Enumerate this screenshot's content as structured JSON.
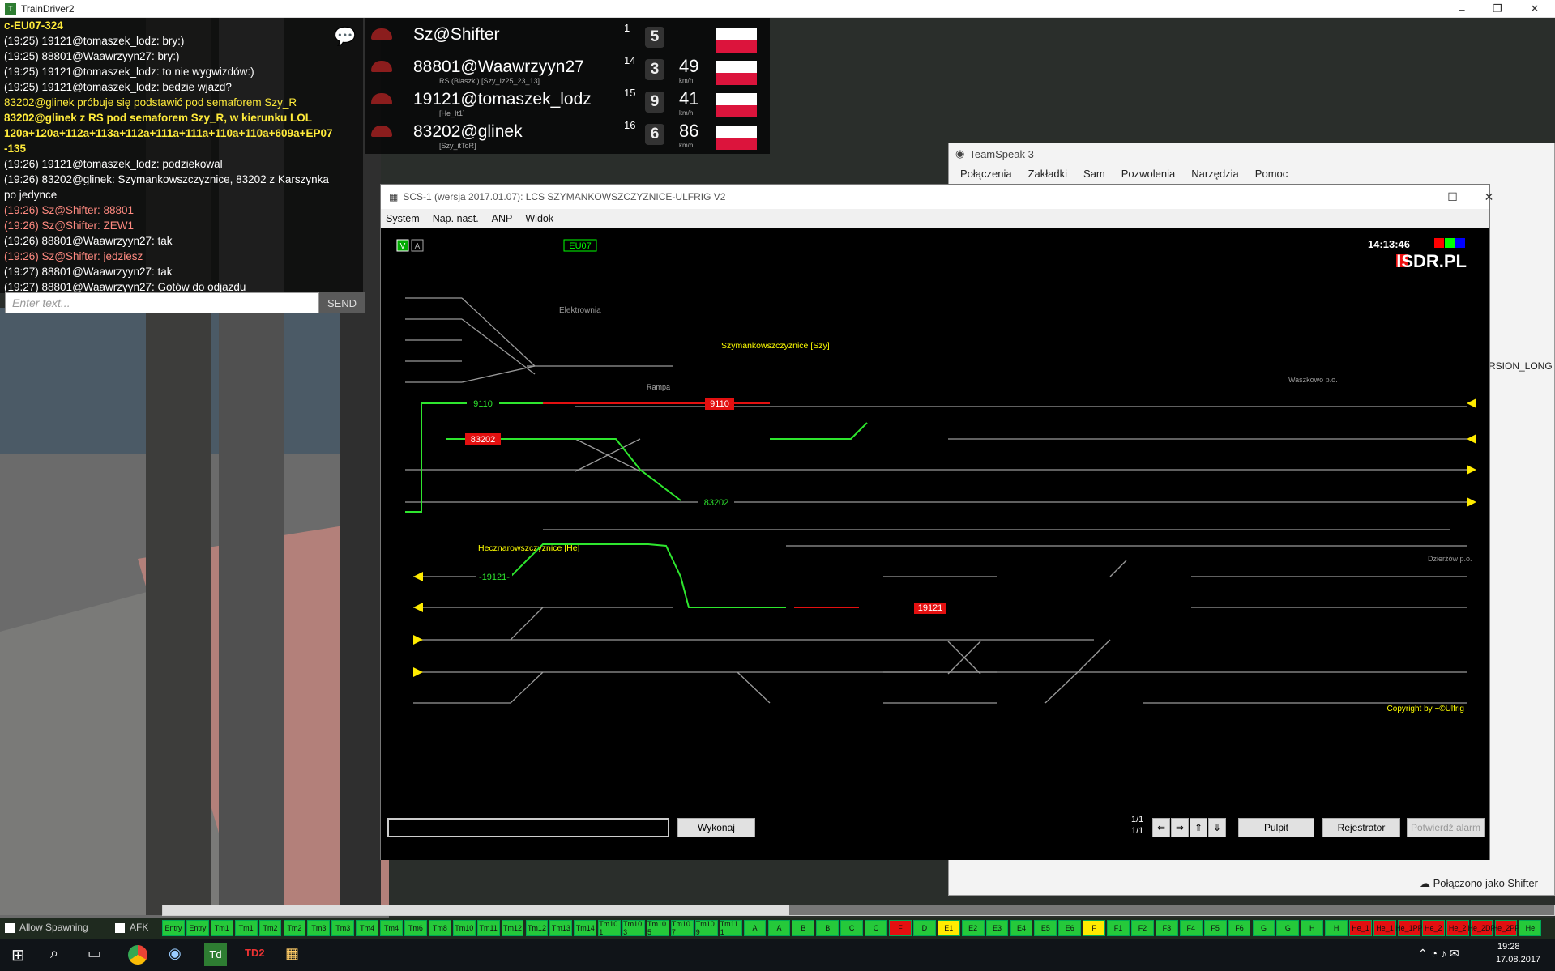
{
  "window_title": "TrainDriver2",
  "chat": {
    "lines": [
      {
        "t": "c-EU07-324",
        "c": "y"
      },
      {
        "t": "(19:25) 19121@tomaszek_lodz: bry:)",
        "c": ""
      },
      {
        "t": "(19:25) 88801@Waawrzyyn27: bry:)",
        "c": ""
      },
      {
        "t": "(19:25) 19121@tomaszek_lodz: to nie wygwizdów:)",
        "c": ""
      },
      {
        "t": "(19:25) 19121@tomaszek_lodz: bedzie wjazd?",
        "c": ""
      },
      {
        "t": "83202@glinek próbuje się podstawić pod semaforem Szy_R",
        "c": "yl"
      },
      {
        "t": "83202@glinek z RS pod semaforem Szy_R, w kierunku LOL",
        "c": "y"
      },
      {
        "t": "120a+120a+112a+113a+112a+111a+111a+110a+110a+609a+EP07",
        "c": "y"
      },
      {
        "t": "-135",
        "c": "y"
      },
      {
        "t": "(19:26) 19121@tomaszek_lodz: podziekowal",
        "c": ""
      },
      {
        "t": "(19:26) 83202@glinek: Szymankowszczyznice, 83202 z Karszynka",
        "c": ""
      },
      {
        "t": "po jedynce",
        "c": ""
      },
      {
        "t": "(19:26) Sz@Shifter: 88801",
        "c": "r"
      },
      {
        "t": "(19:26) Sz@Shifter: ZEW1",
        "c": "r"
      },
      {
        "t": "(19:26) 88801@Waawrzyyn27: tak",
        "c": ""
      },
      {
        "t": "(19:26) Sz@Shifter: jedziesz",
        "c": "r"
      },
      {
        "t": "(19:27) 88801@Waawrzyyn27: tak",
        "c": ""
      },
      {
        "t": "(19:27) 88801@Waawrzyyn27: Gotów do odjazdu",
        "c": ""
      }
    ],
    "placeholder": "Enter text...",
    "send": "SEND"
  },
  "players": [
    {
      "name": "Sz@Shifter",
      "rank": "1",
      "level": "5",
      "speed": "",
      "sub": ""
    },
    {
      "name": "88801@Waawrzyyn27",
      "rank": "14",
      "level": "3",
      "speed": "49",
      "sub": "RS (Blaszki)   [Szy_Iz25_23_13]"
    },
    {
      "name": "19121@tomaszek_lodz",
      "rank": "15",
      "level": "9",
      "speed": "41",
      "sub": "[He_It1]"
    },
    {
      "name": "83202@glinek",
      "rank": "16",
      "level": "6",
      "speed": "86",
      "sub": "[Szy_itToR]"
    }
  ],
  "speed_unit": "km/h",
  "teamspeak": {
    "title": "TeamSpeak 3",
    "menu": [
      "Połączenia",
      "Zakładki",
      "Sam",
      "Pozwolenia",
      "Narzędzia",
      "Pomoc"
    ],
    "side_text": "RSION_LONG",
    "status": "Połączono jako Shifter"
  },
  "scs": {
    "title": "SCS-1 (wersja 2017.01.07): LCS SZYMANKOWSZCZYZNICE-ULFRIG V2",
    "menu": [
      "System",
      "Nap. nast.",
      "ANP",
      "Widok"
    ],
    "clock": "14:13:46",
    "brand": "ISDR.PL",
    "loco": "EU07",
    "copyright": "Copyright by ~©Ulfrig",
    "station_szy": "Szymankowszczyznice [Szy]",
    "station_he": "Hecznarowszczyznice [He]",
    "elektronika": "Elektrownia",
    "rampa": "Rampa",
    "waszkowo": "Waszkowo p.o.",
    "dzierzow": "Dzierżów p.o.",
    "trains": {
      "t1": "9110",
      "t2": "83202",
      "t3": "9110",
      "t4": "83202",
      "t5": "19121",
      "t6": "-19121-"
    },
    "buttons": {
      "exec": "Wykonaj",
      "pulpit": "Pulpit",
      "rejestrator": "Rejestrator",
      "alarm": "Potwierdź alarm"
    },
    "page1": "1/1",
    "page2": "1/1"
  },
  "bottom_buttons": [
    "Entry",
    "Entry",
    "Tm1",
    "Tm1",
    "Tm2",
    "Tm2",
    "Tm3",
    "Tm3",
    "Tm4",
    "Tm4",
    "Tm6",
    "Tm8",
    "Tm10",
    "Tm11",
    "Tm12",
    "Tm12",
    "Tm13",
    "Tm14",
    "Tm10 1",
    "Tm10 3",
    "Tm10 5",
    "Tm10 7",
    "Tm10 9",
    "Tm11 1",
    "A",
    "A",
    "B",
    "B",
    "C",
    "C",
    "F",
    "D",
    "E1",
    "E2",
    "E3",
    "E4",
    "E5",
    "E6",
    "F",
    "F1",
    "F2",
    "F3",
    "F4",
    "F5",
    "F6",
    "G",
    "G",
    "H",
    "H",
    "He_1",
    "He_1",
    "He_1PP",
    "He_2",
    "He_2",
    "He_2DP",
    "He_2PP",
    "He"
  ],
  "bottom_toggles": {
    "spawn": "Allow Spawning",
    "afk": "AFK"
  },
  "clock_date": {
    "time": "19:28",
    "date": "17.08.2017"
  }
}
